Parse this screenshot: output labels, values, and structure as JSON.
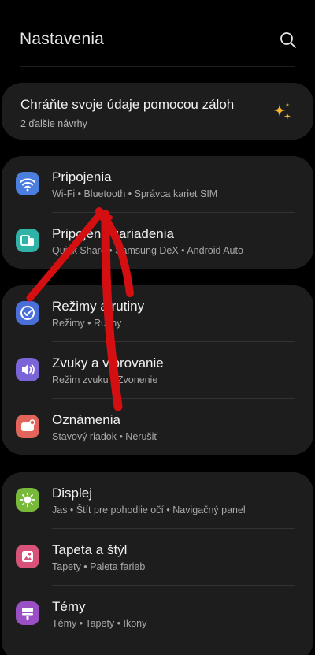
{
  "header": {
    "title": "Nastavenia",
    "search_icon": "search-icon"
  },
  "suggestion": {
    "title": "Chráňte svoje údaje pomocou záloh",
    "subtitle": "2 ďalšie návrhy",
    "icon": "sparkle-icon"
  },
  "groups": [
    [
      {
        "title": "Pripojenia",
        "subtitle": "Wi-Fi  •  Bluetooth  •  Správca kariet SIM",
        "icon": "wifi-icon",
        "color": "#4a7fe0"
      },
      {
        "title": "Pripojené zariadenia",
        "subtitle": "Quick Share  •  Samsung DeX  •  Android Auto",
        "icon": "connected-devices-icon",
        "color": "#2fb3a6"
      }
    ],
    [
      {
        "title": "Režimy a rutiny",
        "subtitle": "Režimy  •  Rutiny",
        "icon": "modes-routines-icon",
        "color": "#4a6fd8"
      },
      {
        "title": "Zvuky a vibrovanie",
        "subtitle": "Režim zvuku  •  Zvonenie",
        "icon": "sound-icon",
        "color": "#7b63d8"
      },
      {
        "title": "Oznámenia",
        "subtitle": "Stavový riadok  •  Nerušiť",
        "icon": "notifications-icon",
        "color": "#e2645a"
      }
    ],
    [
      {
        "title": "Displej",
        "subtitle": "Jas  •  Štít pre pohodlie očí  •  Navigačný panel",
        "icon": "display-brightness-icon",
        "color": "#78b93a"
      },
      {
        "title": "Tapeta a štýl",
        "subtitle": "Tapety  •  Paleta farieb",
        "icon": "wallpaper-icon",
        "color": "#d8527a"
      },
      {
        "title": "Témy",
        "subtitle": "Témy  •  Tapety  •  Ikony",
        "icon": "themes-icon",
        "color": "#9a4fc4"
      }
    ]
  ],
  "colors": {
    "background": "#000000",
    "card": "#1d1d1d",
    "annotation_arrow": "#d40f12"
  }
}
